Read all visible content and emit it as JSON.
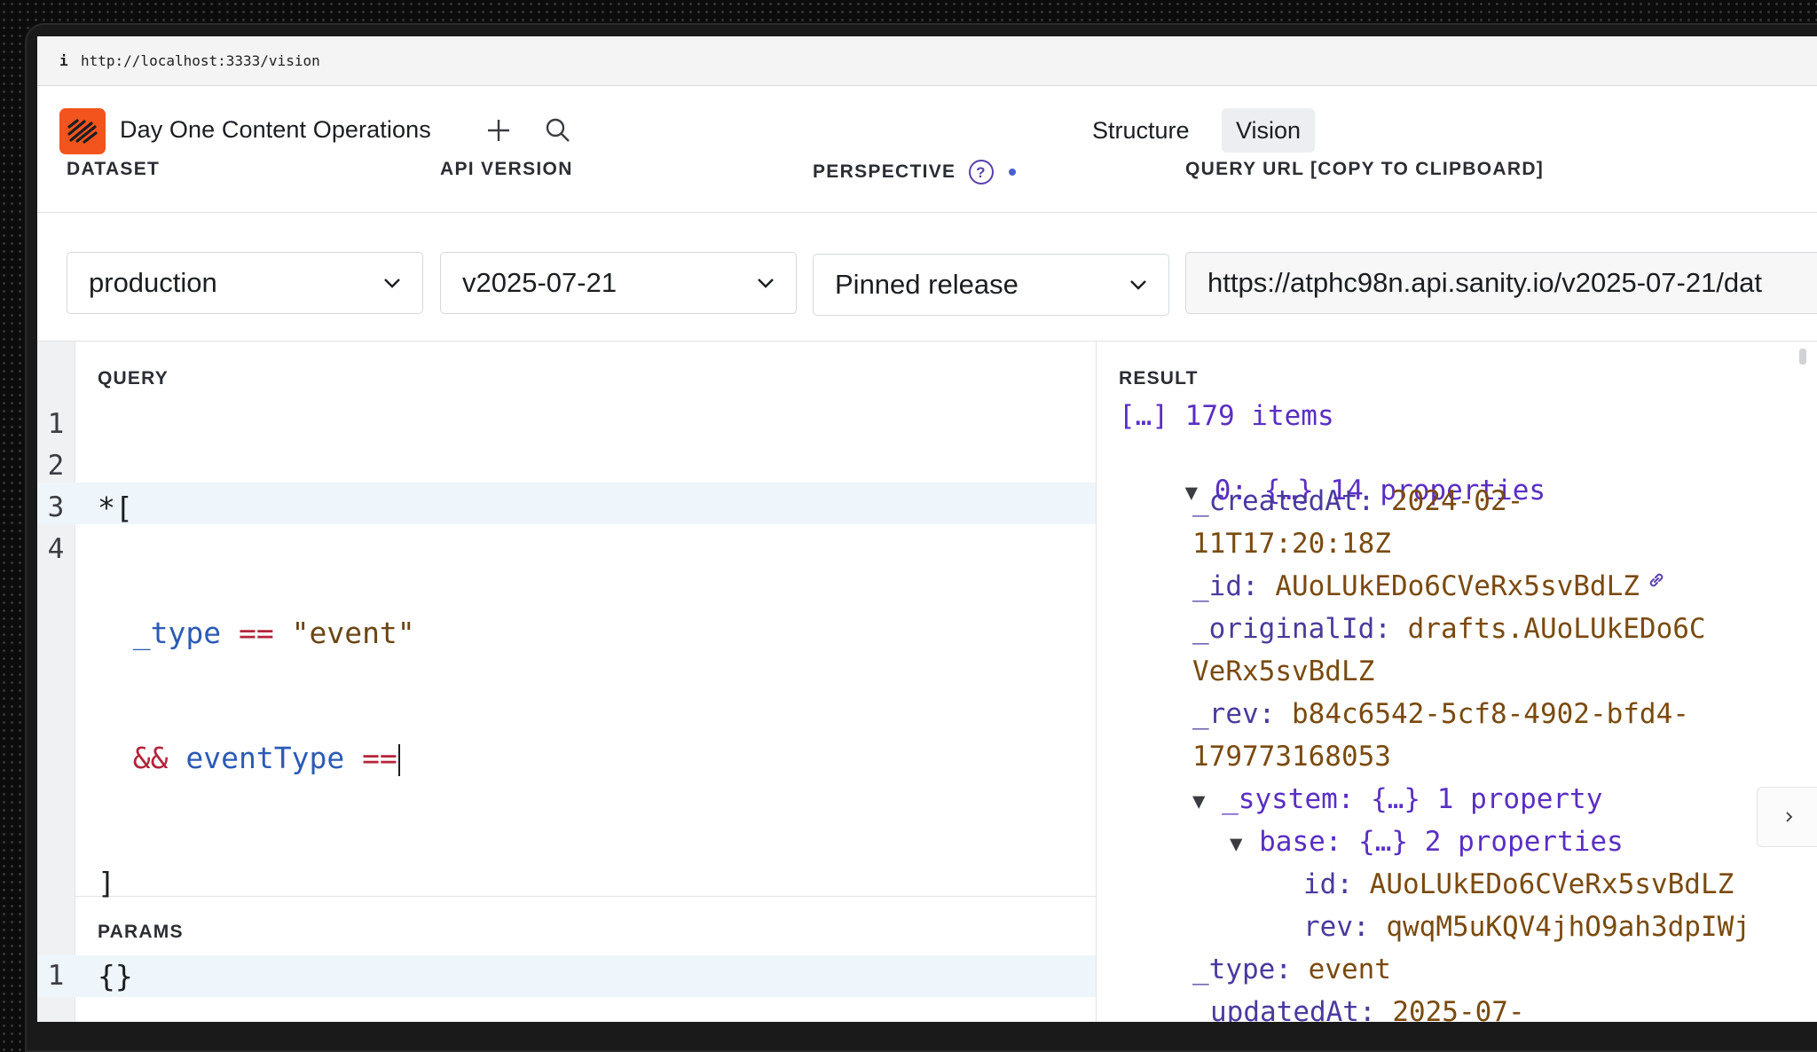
{
  "browser": {
    "info_icon": "i",
    "url": "http://localhost:3333/vision"
  },
  "header": {
    "app_title": "Day One Content Operations",
    "tabs": [
      {
        "label": "Structure",
        "active": false
      },
      {
        "label": "Vision",
        "active": true
      }
    ],
    "icons": [
      "plus-icon",
      "search-icon"
    ],
    "accent": "#f3541d"
  },
  "controls": {
    "dataset": {
      "label": "DATASET",
      "value": "production"
    },
    "api_version": {
      "label": "API VERSION",
      "value": "v2025-07-21"
    },
    "perspective": {
      "label": "PERSPECTIVE",
      "value": "Pinned release"
    },
    "query_url": {
      "label": "QUERY URL [COPY TO CLIPBOARD]",
      "value": "https://atphc98n.api.sanity.io/v2025-07-21/dat"
    }
  },
  "query": {
    "label": "QUERY",
    "line_numbers": [
      "1",
      "2",
      "3",
      "4"
    ],
    "l1": "*[",
    "l2_key": "_type",
    "l2_op": "==",
    "l2_str": "\"event\"",
    "l3_op": "&&",
    "l3_key": "eventType",
    "l3_op2": "==",
    "l4": "]"
  },
  "params": {
    "label": "PARAMS",
    "line_number": "1",
    "value": "{}"
  },
  "result": {
    "label": "RESULT",
    "summary": "[…] 179 items",
    "item0": "0: {…} 14 properties",
    "createdAt_key": "_createdAt:",
    "createdAt_a": "2024-02-",
    "createdAt_b": "11T17:20:18Z",
    "id_key": "_id:",
    "id_val": "AUoLUkEDo6CVeRx5svBdLZ",
    "originalId_key": "_originalId:",
    "originalId_a": "drafts.AUoLUkEDo6C",
    "originalId_b": "VeRx5svBdLZ",
    "rev_key": "_rev:",
    "rev_a": "b84c6542-5cf8-4902-bfd4-",
    "rev_b": "179773168053",
    "system": "_system: {…} 1 property",
    "base": "base: {…} 2 properties",
    "base_id_key": "id:",
    "base_id_val": "AUoLUkEDo6CVeRx5svBdLZ",
    "base_rev_key": "rev:",
    "base_rev_val": "qwqM5uKQV4jhO9ah3dpIWj",
    "type_key": "_type:",
    "type_val": "event",
    "updatedAt_key": "updatedAt:",
    "updatedAt_a": "2025-07-"
  }
}
